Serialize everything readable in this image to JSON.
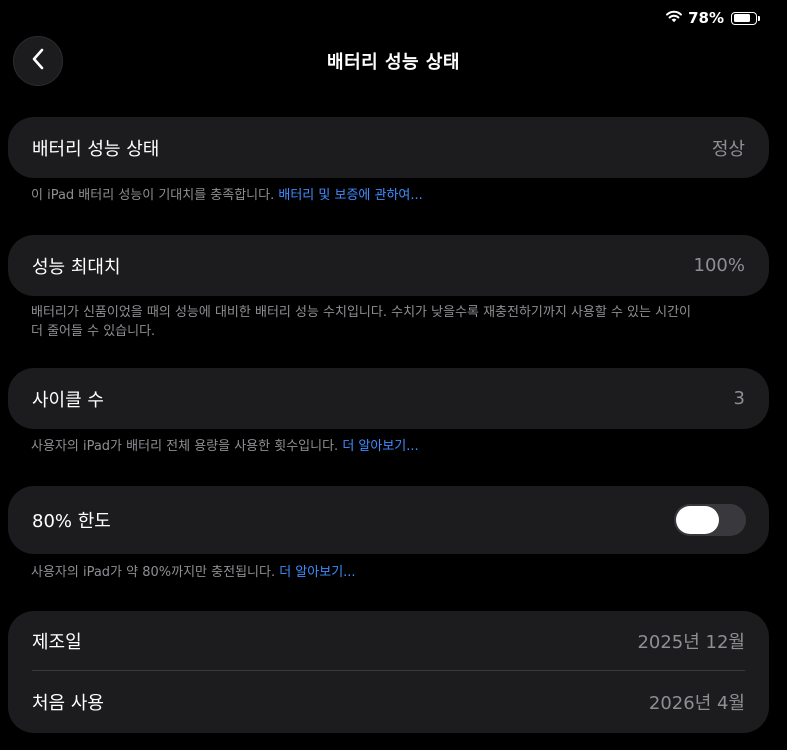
{
  "status_bar": {
    "battery_percent": "78%",
    "battery_level": 0.78
  },
  "nav": {
    "title": "배터리 성능 상태"
  },
  "health": {
    "label": "배터리 성능 상태",
    "value": "정상",
    "footnote": "이 iPad 배터리 성능이 기대치를 충족합니다. ",
    "footnote_link": "배터리 및 보증에 관하여..."
  },
  "max_capacity": {
    "label": "성능 최대치",
    "value": "100%",
    "footnote_line1": "배터리가 신품이었을 때의 성능에 대비한 배터리 성능 수치입니다. 수치가 낮을수록 재충전하기까지 사용할 수 있는 시간이",
    "footnote_line2": "더 줄어들 수 있습니다."
  },
  "cycle_count": {
    "label": "사이클 수",
    "value": "3",
    "footnote": "사용자의 iPad가 배터리 전체 용량을 사용한 횟수입니다. ",
    "footnote_link": "더 알아보기..."
  },
  "limit_80": {
    "label": "80% 한도",
    "toggle_on": false,
    "footnote": "사용자의 iPad가 약 80%까지만 충전됩니다. ",
    "footnote_link": "더 알아보기..."
  },
  "dates": {
    "manufacture_label": "제조일",
    "manufacture_value": "2025년 12월",
    "first_use_label": "처음 사용",
    "first_use_value": "2026년 4월"
  },
  "colors": {
    "background": "#000000",
    "card": "#1c1c1e",
    "secondary_text": "#8e8e93",
    "link": "#3f8cff",
    "toggle_off": "#39393d"
  }
}
